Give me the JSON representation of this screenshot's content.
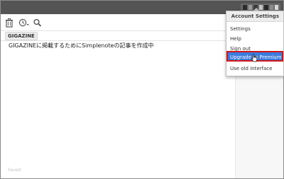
{
  "app": {
    "tag": "GIGAZINE",
    "note_text": "GIGAZINEに掲載するためにSimplenoteの記事を作成中",
    "status": "Saved"
  },
  "toolbar": {
    "icons": [
      "trash-icon",
      "history-icon",
      "search-icon"
    ]
  },
  "account_menu": {
    "title": "Account Settings",
    "items": [
      "Settings",
      "Help",
      "Sign out",
      "Upgrade to Premium",
      "Use old interface"
    ],
    "highlighted_index": 3
  },
  "colors": {
    "topbar": "#545454",
    "highlight": "#3d7bdc",
    "highlight_border": "#d01616"
  }
}
